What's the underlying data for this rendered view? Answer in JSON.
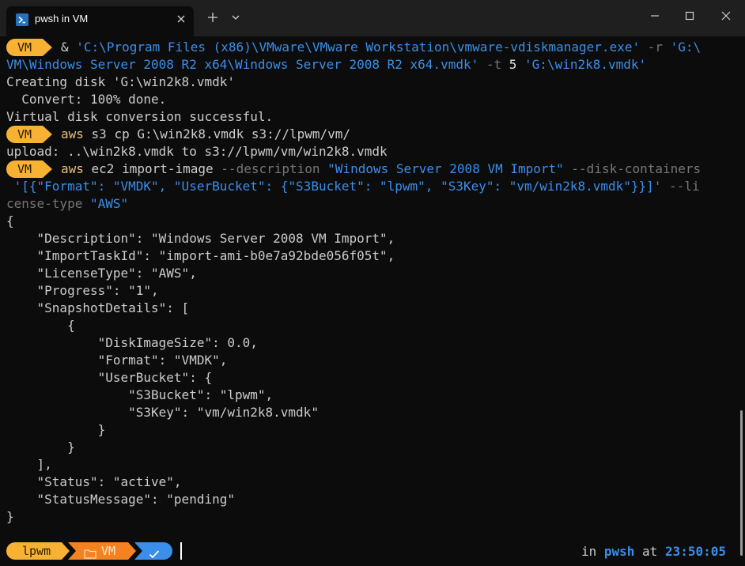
{
  "window": {
    "tab_title": "pwsh in VM",
    "tab_icon": "powershell-icon",
    "new_tab_icon": "plus-icon",
    "dropdown_icon": "chevron-down-icon",
    "minimize_icon": "minimize-icon",
    "maximize_icon": "maximize-icon",
    "close_icon": "close-icon"
  },
  "prompt": {
    "dir": "VM",
    "color": "#f7b233"
  },
  "terminal": {
    "cmd1_amp": "& ",
    "cmd1_path": "'C:\\Program Files (x86)\\VMware\\VMware Workstation\\vmware-vdiskmanager.exe'",
    "cmd1_r": " -r ",
    "cmd1_src_a": "'G:\\",
    "cmd1_src_b": "VM\\Windows Server 2008 R2 x64\\Windows Server 2008 R2 x64.vmdk'",
    "cmd1_t": " -t ",
    "cmd1_five": "5",
    "cmd1_dest": " 'G:\\win2k8.vmdk'",
    "out1": "Creating disk 'G:\\win2k8.vmdk'",
    "out2": "  Convert: 100% done.",
    "out3": "Virtual disk conversion successful.",
    "cmd2_name": "aws",
    "cmd2_rest": " s3 cp G:\\win2k8.vmdk s3://lpwm/vm/",
    "out4": "upload: ..\\win2k8.vmdk to s3://lpwm/vm/win2k8.vmdk",
    "cmd3_name": "aws",
    "cmd3_rest": " ec2 import-image ",
    "cmd3_desc_flag": "--description",
    "cmd3_desc_val": " \"Windows Server 2008 VM Import\"",
    "cmd3_disk_flag": " --disk-containers",
    "cmd3_json": " '[{\"Format\": \"VMDK\", \"UserBucket\": {\"S3Bucket\": \"lpwm\", \"S3Key\": \"vm/win2k8.vmdk\"}}]'",
    "cmd3_lic_a": " --li",
    "cmd3_lic_b": "cense-type",
    "cmd3_lic_val": " \"AWS\"",
    "json_lines": [
      "{",
      "    \"Description\": \"Windows Server 2008 VM Import\",",
      "    \"ImportTaskId\": \"import-ami-b0e7a92bde056f05t\",",
      "    \"LicenseType\": \"AWS\",",
      "    \"Progress\": \"1\",",
      "    \"SnapshotDetails\": [",
      "        {",
      "            \"DiskImageSize\": 0.0,",
      "            \"Format\": \"VMDK\",",
      "            \"UserBucket\": {",
      "                \"S3Bucket\": \"lpwm\",",
      "                \"S3Key\": \"vm/win2k8.vmdk\"",
      "            }",
      "        }",
      "    ],",
      "    \"Status\": \"active\",",
      "    \"StatusMessage\": \"pending\"",
      "}"
    ]
  },
  "statusbar": {
    "user": "lpwm",
    "folder_icon": "folder-icon",
    "dir": "VM",
    "check_icon": "check-icon",
    "in_label": "in ",
    "shell": "pwsh",
    "at_label": " at ",
    "time": "23:50:05",
    "colors": {
      "user": "#f7b233",
      "dir": "#f58220",
      "check": "#3b8eea"
    }
  }
}
